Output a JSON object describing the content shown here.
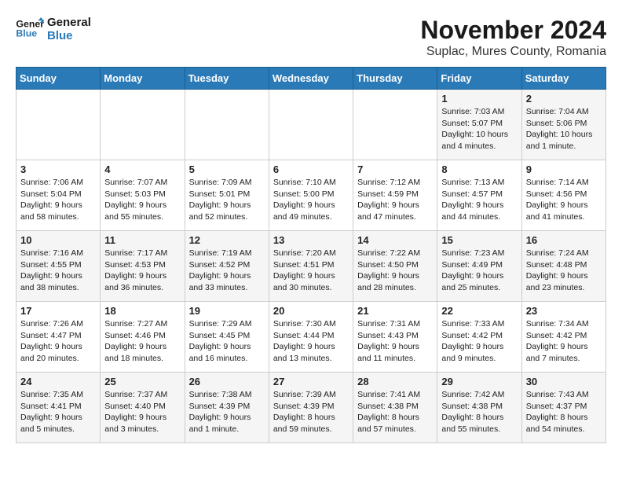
{
  "logo": {
    "line1": "General",
    "line2": "Blue"
  },
  "title": "November 2024",
  "subtitle": "Suplac, Mures County, Romania",
  "days_of_week": [
    "Sunday",
    "Monday",
    "Tuesday",
    "Wednesday",
    "Thursday",
    "Friday",
    "Saturday"
  ],
  "weeks": [
    [
      {
        "day": "",
        "content": ""
      },
      {
        "day": "",
        "content": ""
      },
      {
        "day": "",
        "content": ""
      },
      {
        "day": "",
        "content": ""
      },
      {
        "day": "",
        "content": ""
      },
      {
        "day": "1",
        "content": "Sunrise: 7:03 AM\nSunset: 5:07 PM\nDaylight: 10 hours\nand 4 minutes."
      },
      {
        "day": "2",
        "content": "Sunrise: 7:04 AM\nSunset: 5:06 PM\nDaylight: 10 hours\nand 1 minute."
      }
    ],
    [
      {
        "day": "3",
        "content": "Sunrise: 7:06 AM\nSunset: 5:04 PM\nDaylight: 9 hours\nand 58 minutes."
      },
      {
        "day": "4",
        "content": "Sunrise: 7:07 AM\nSunset: 5:03 PM\nDaylight: 9 hours\nand 55 minutes."
      },
      {
        "day": "5",
        "content": "Sunrise: 7:09 AM\nSunset: 5:01 PM\nDaylight: 9 hours\nand 52 minutes."
      },
      {
        "day": "6",
        "content": "Sunrise: 7:10 AM\nSunset: 5:00 PM\nDaylight: 9 hours\nand 49 minutes."
      },
      {
        "day": "7",
        "content": "Sunrise: 7:12 AM\nSunset: 4:59 PM\nDaylight: 9 hours\nand 47 minutes."
      },
      {
        "day": "8",
        "content": "Sunrise: 7:13 AM\nSunset: 4:57 PM\nDaylight: 9 hours\nand 44 minutes."
      },
      {
        "day": "9",
        "content": "Sunrise: 7:14 AM\nSunset: 4:56 PM\nDaylight: 9 hours\nand 41 minutes."
      }
    ],
    [
      {
        "day": "10",
        "content": "Sunrise: 7:16 AM\nSunset: 4:55 PM\nDaylight: 9 hours\nand 38 minutes."
      },
      {
        "day": "11",
        "content": "Sunrise: 7:17 AM\nSunset: 4:53 PM\nDaylight: 9 hours\nand 36 minutes."
      },
      {
        "day": "12",
        "content": "Sunrise: 7:19 AM\nSunset: 4:52 PM\nDaylight: 9 hours\nand 33 minutes."
      },
      {
        "day": "13",
        "content": "Sunrise: 7:20 AM\nSunset: 4:51 PM\nDaylight: 9 hours\nand 30 minutes."
      },
      {
        "day": "14",
        "content": "Sunrise: 7:22 AM\nSunset: 4:50 PM\nDaylight: 9 hours\nand 28 minutes."
      },
      {
        "day": "15",
        "content": "Sunrise: 7:23 AM\nSunset: 4:49 PM\nDaylight: 9 hours\nand 25 minutes."
      },
      {
        "day": "16",
        "content": "Sunrise: 7:24 AM\nSunset: 4:48 PM\nDaylight: 9 hours\nand 23 minutes."
      }
    ],
    [
      {
        "day": "17",
        "content": "Sunrise: 7:26 AM\nSunset: 4:47 PM\nDaylight: 9 hours\nand 20 minutes."
      },
      {
        "day": "18",
        "content": "Sunrise: 7:27 AM\nSunset: 4:46 PM\nDaylight: 9 hours\nand 18 minutes."
      },
      {
        "day": "19",
        "content": "Sunrise: 7:29 AM\nSunset: 4:45 PM\nDaylight: 9 hours\nand 16 minutes."
      },
      {
        "day": "20",
        "content": "Sunrise: 7:30 AM\nSunset: 4:44 PM\nDaylight: 9 hours\nand 13 minutes."
      },
      {
        "day": "21",
        "content": "Sunrise: 7:31 AM\nSunset: 4:43 PM\nDaylight: 9 hours\nand 11 minutes."
      },
      {
        "day": "22",
        "content": "Sunrise: 7:33 AM\nSunset: 4:42 PM\nDaylight: 9 hours\nand 9 minutes."
      },
      {
        "day": "23",
        "content": "Sunrise: 7:34 AM\nSunset: 4:42 PM\nDaylight: 9 hours\nand 7 minutes."
      }
    ],
    [
      {
        "day": "24",
        "content": "Sunrise: 7:35 AM\nSunset: 4:41 PM\nDaylight: 9 hours\nand 5 minutes."
      },
      {
        "day": "25",
        "content": "Sunrise: 7:37 AM\nSunset: 4:40 PM\nDaylight: 9 hours\nand 3 minutes."
      },
      {
        "day": "26",
        "content": "Sunrise: 7:38 AM\nSunset: 4:39 PM\nDaylight: 9 hours\nand 1 minute."
      },
      {
        "day": "27",
        "content": "Sunrise: 7:39 AM\nSunset: 4:39 PM\nDaylight: 8 hours\nand 59 minutes."
      },
      {
        "day": "28",
        "content": "Sunrise: 7:41 AM\nSunset: 4:38 PM\nDaylight: 8 hours\nand 57 minutes."
      },
      {
        "day": "29",
        "content": "Sunrise: 7:42 AM\nSunset: 4:38 PM\nDaylight: 8 hours\nand 55 minutes."
      },
      {
        "day": "30",
        "content": "Sunrise: 7:43 AM\nSunset: 4:37 PM\nDaylight: 8 hours\nand 54 minutes."
      }
    ]
  ]
}
